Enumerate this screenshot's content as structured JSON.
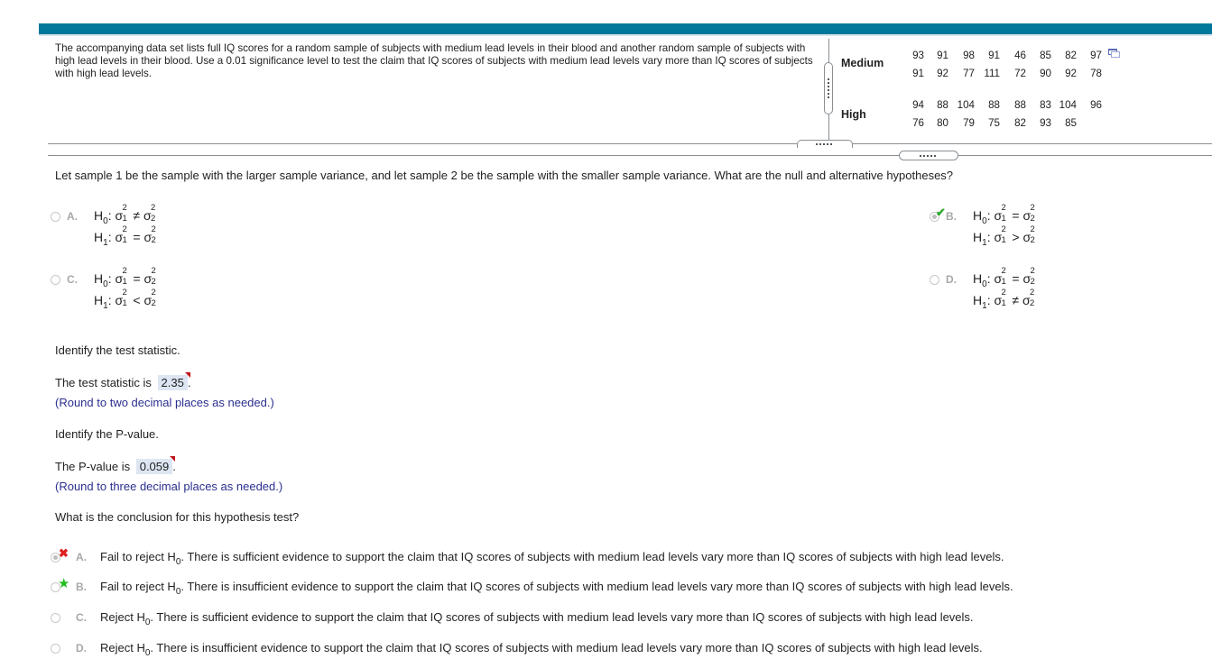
{
  "intro": {
    "text": "The accompanying data set lists full IQ scores for a random sample of subjects with medium lead levels in their blood and another random sample of subjects with high lead levels in their blood. Use a 0.01 significance level to test the claim that IQ scores of subjects with medium lead levels vary more than IQ scores of subjects with high lead levels."
  },
  "dataset": {
    "groups": [
      {
        "label": "Medium",
        "rows": [
          [
            "93",
            "91",
            "98",
            "91",
            "46",
            "85",
            "82",
            "97"
          ],
          [
            "91",
            "92",
            "77",
            "111",
            "72",
            "90",
            "92",
            "78"
          ]
        ]
      },
      {
        "label": "High",
        "rows": [
          [
            "94",
            "88",
            "104",
            "88",
            "88",
            "83",
            "104",
            "96"
          ],
          [
            "76",
            "80",
            "79",
            "75",
            "82",
            "93",
            "85"
          ]
        ]
      }
    ],
    "popout_icon": "popout-window-icon"
  },
  "question1": {
    "prompt": "Let sample 1 be the sample with the larger sample variance, and let sample 2 be the sample with the smaller sample variance. What are the null and alternative hypotheses?",
    "options": [
      {
        "letter": "A.",
        "h0_label": "H",
        "h0_sub": "0",
        "h0_rel": "≠",
        "h1_label": "H",
        "h1_sub": "1",
        "h1_rel": "=",
        "selected": false
      },
      {
        "letter": "B.",
        "h0_label": "H",
        "h0_sub": "0",
        "h0_rel": "=",
        "h1_label": "H",
        "h1_sub": "1",
        "h1_rel": ">",
        "selected": true,
        "mark": "correct-check"
      },
      {
        "letter": "C.",
        "h0_label": "H",
        "h0_sub": "0",
        "h0_rel": "=",
        "h1_label": "H",
        "h1_sub": "1",
        "h1_rel": "<",
        "selected": false
      },
      {
        "letter": "D.",
        "h0_label": "H",
        "h0_sub": "0",
        "h0_rel": "=",
        "h1_label": "H",
        "h1_sub": "1",
        "h1_rel": "≠",
        "selected": false
      }
    ],
    "sigma": "σ",
    "sup": "2",
    "sub1": "1",
    "sub2": "2",
    "colon": ":"
  },
  "test_statistic": {
    "prompt": "Identify the test statistic.",
    "lead": "The test statistic is",
    "value": "2.35",
    "trail": ".",
    "hint": "(Round to two decimal places as needed.)"
  },
  "p_value": {
    "prompt": "Identify the P-value.",
    "lead": "The P-value is",
    "value": "0.059",
    "trail": ".",
    "hint": "(Round to three decimal places as needed.)"
  },
  "conclusion": {
    "prompt": "What is the conclusion for this hypothesis test?",
    "options": [
      {
        "letter": "A.",
        "pre": "Fail to reject H",
        "sub": "0",
        "post": ". There is sufficient evidence to support the claim that IQ scores of subjects with medium lead levels vary more than IQ scores of subjects with high lead levels.",
        "selected": true,
        "mark": "incorrect-x"
      },
      {
        "letter": "B.",
        "pre": "Fail to reject H",
        "sub": "0",
        "post": ". There is insufficient evidence to support the claim that IQ scores of subjects with medium lead levels vary more than IQ scores of subjects with high lead levels.",
        "selected": false,
        "mark": "correct-star"
      },
      {
        "letter": "C.",
        "pre": "Reject H",
        "sub": "0",
        "post": ". There is sufficient evidence to support the claim that IQ scores of subjects with medium lead levels vary more than IQ scores of subjects with high lead levels.",
        "selected": false
      },
      {
        "letter": "D.",
        "pre": "Reject H",
        "sub": "0",
        "post": ". There is insufficient evidence to support the claim that IQ scores of subjects with medium lead levels vary more than IQ scores of subjects with high lead levels.",
        "selected": false
      }
    ]
  },
  "marks": {
    "check": "✔",
    "x": "✖",
    "star": "★"
  },
  "colors": {
    "header": "#00789a",
    "answer_bg": "#dde6f2",
    "hint": "#2b2f8f",
    "correct": "#2fa82f",
    "incorrect": "#e02020",
    "flag": "#c0141b"
  }
}
